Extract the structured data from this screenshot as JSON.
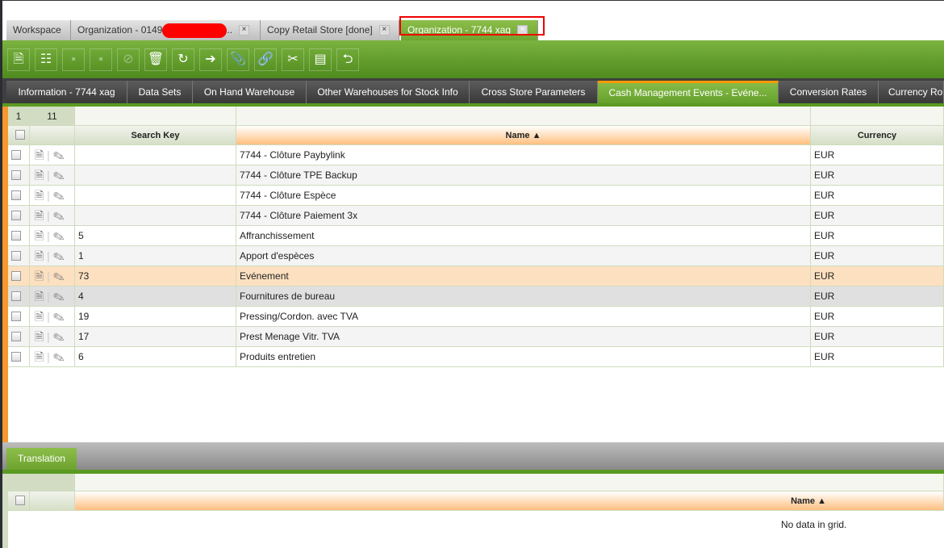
{
  "tabs": [
    {
      "label": "Workspace"
    },
    {
      "label": "Organization - 0149",
      "suffix": ".."
    },
    {
      "label": "Copy Retail Store [done]"
    },
    {
      "label": "Organization - 7744 xag"
    }
  ],
  "toolbar": {
    "icons": [
      "new-document-icon",
      "new-grid-icon",
      "save-icon",
      "save-close-icon",
      "cancel-icon",
      "delete-icon",
      "refresh-icon",
      "export-icon",
      "attach-icon",
      "link-icon",
      "audit-icon",
      "layout-icon",
      "workflow-icon"
    ]
  },
  "subtabs": [
    "Information - 7744 xag",
    "Data Sets",
    "On Hand Warehouse",
    "Other Warehouses for Stock Info",
    "Cross Store Parameters",
    "Cash Management Events - Evéne...",
    "Conversion Rates",
    "Currency Ro"
  ],
  "grid": {
    "pager": {
      "page": "1",
      "count": "11"
    },
    "columns": {
      "search_key": "Search Key",
      "name": "Name ▲",
      "currency": "Currency"
    },
    "rows": [
      {
        "key": "",
        "name": "7744 - Clôture  Paybylink",
        "currency": "EUR"
      },
      {
        "key": "",
        "name": "7744 - Clôture  TPE Backup",
        "currency": "EUR"
      },
      {
        "key": "",
        "name": "7744 - Clôture Espèce",
        "currency": "EUR"
      },
      {
        "key": "",
        "name": "7744 - Clôture Paiement 3x",
        "currency": "EUR"
      },
      {
        "key": "5",
        "name": "Affranchissement",
        "currency": "EUR"
      },
      {
        "key": "1",
        "name": "Apport d'espèces",
        "currency": "EUR"
      },
      {
        "key": "73",
        "name": "Evénement",
        "currency": "EUR"
      },
      {
        "key": "4",
        "name": "Fournitures de bureau",
        "currency": "EUR"
      },
      {
        "key": "19",
        "name": "Pressing/Cordon. avec TVA",
        "currency": "EUR"
      },
      {
        "key": "17",
        "name": "Prest Menage Vitr. TVA",
        "currency": "EUR"
      },
      {
        "key": "6",
        "name": "Produits entretien",
        "currency": "EUR"
      }
    ]
  },
  "translation": {
    "tab": "Translation",
    "name_col": "Name ▲",
    "empty": "No data in grid."
  }
}
